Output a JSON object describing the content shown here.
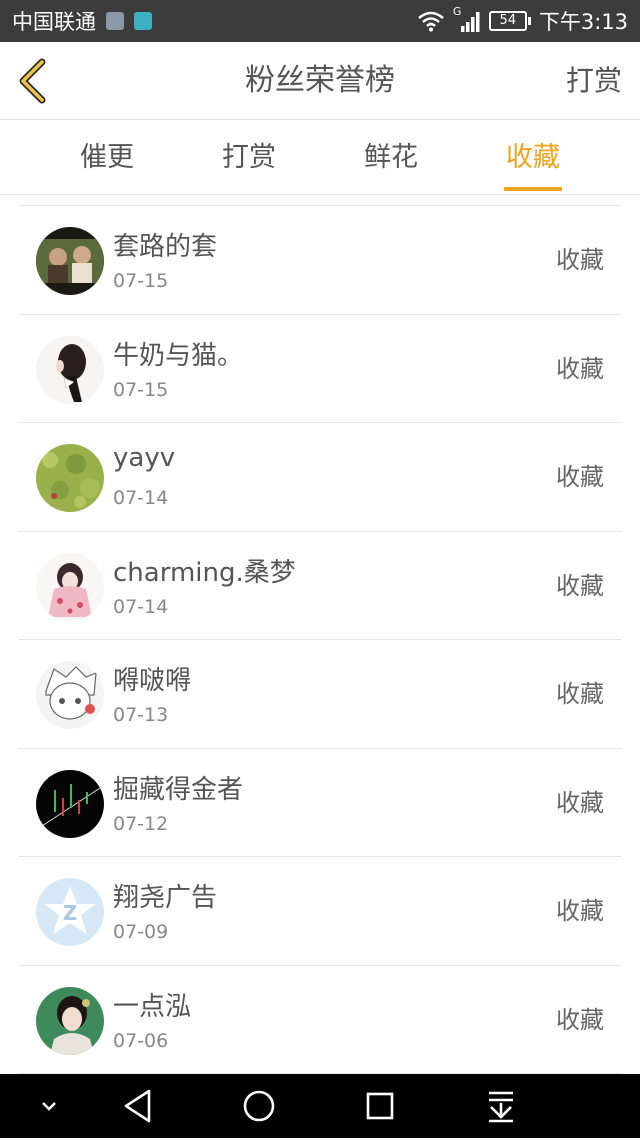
{
  "status_bar": {
    "carrier": "中国联通",
    "network_type": "G",
    "battery": "54",
    "time": "下午3:13"
  },
  "header": {
    "title": "粉丝荣誉榜",
    "action_label": "打赏"
  },
  "tabs": [
    {
      "label": "催更",
      "active": false
    },
    {
      "label": "打赏",
      "active": false
    },
    {
      "label": "鲜花",
      "active": false
    },
    {
      "label": "收藏",
      "active": true
    }
  ],
  "list": [
    {
      "name": "套路的套",
      "date": "07-15",
      "action": "收藏"
    },
    {
      "name": "牛奶与猫。",
      "date": "07-15",
      "action": "收藏"
    },
    {
      "name": "yayv",
      "date": "07-14",
      "action": "收藏"
    },
    {
      "name": "charming.桑梦",
      "date": "07-14",
      "action": "收藏"
    },
    {
      "name": "嘚啵嘚",
      "date": "07-13",
      "action": "收藏"
    },
    {
      "name": "掘藏得金者",
      "date": "07-12",
      "action": "收藏"
    },
    {
      "name": "翔尧广告",
      "date": "07-09",
      "action": "收藏"
    },
    {
      "name": "一点泓",
      "date": "07-06",
      "action": "收藏"
    }
  ],
  "colors": {
    "accent": "#f2a31c",
    "status_bar_bg": "#3c3c3c",
    "nav_bar_bg": "#000000"
  },
  "icons": {
    "back": "chevron-left-icon",
    "nav": [
      "chevron-down-icon",
      "back-triangle-icon",
      "home-circle-icon",
      "recents-square-icon",
      "notification-pull-icon"
    ]
  }
}
